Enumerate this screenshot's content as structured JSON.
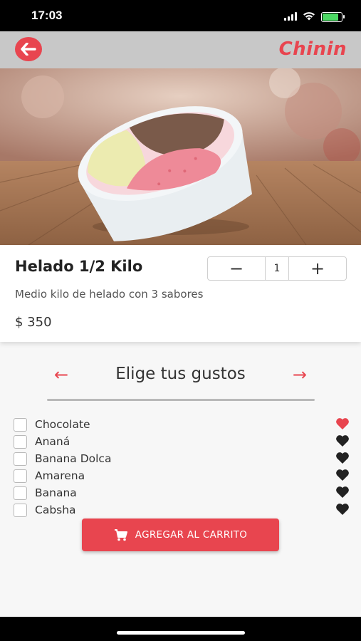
{
  "status_bar": {
    "time": "17:03",
    "battery_level": 0.85
  },
  "header": {
    "back_icon": "arrow-left-icon",
    "brand": "Chinin",
    "brand_color": "#e8454f"
  },
  "product": {
    "name": "Helado 1/2 Kilo",
    "description": "Medio kilo de helado con 3 sabores",
    "price": "$ 350",
    "quantity": "1",
    "decrement_label": "−",
    "increment_label": "+"
  },
  "flavors": {
    "title": "Elige tus gustos",
    "prev_arrow": "←",
    "next_arrow": "→",
    "items": [
      {
        "label": "Chocolate",
        "checked": false,
        "favorite": true
      },
      {
        "label": "Ananá",
        "checked": false,
        "favorite": false
      },
      {
        "label": "Banana Dolca",
        "checked": false,
        "favorite": false
      },
      {
        "label": "Amarena",
        "checked": false,
        "favorite": false
      },
      {
        "label": "Banana",
        "checked": false,
        "favorite": false
      },
      {
        "label": "Cabsha",
        "checked": false,
        "favorite": false
      }
    ]
  },
  "cart_button": {
    "label": "AGREGAR AL CARRITO",
    "icon": "cart-icon"
  },
  "colors": {
    "accent": "#e8454f",
    "heart_active": "#e8454f",
    "heart_inactive": "#222222"
  }
}
